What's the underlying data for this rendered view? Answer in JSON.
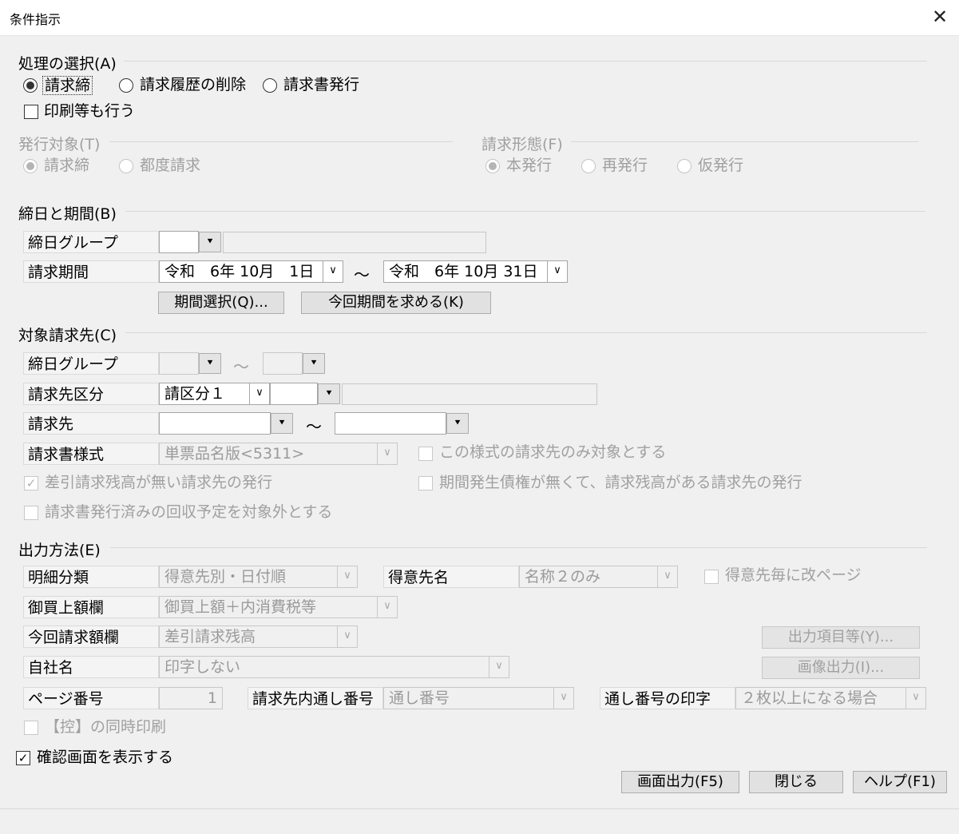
{
  "window": {
    "title": "条件指示"
  },
  "processing": {
    "group_label": "処理の選択(A)",
    "options": [
      "請求締",
      "請求履歴の削除",
      "請求書発行"
    ],
    "print_check": "印刷等も行う"
  },
  "issue_target": {
    "label": "発行対象(T)",
    "options": [
      "請求締",
      "都度請求"
    ]
  },
  "billing_form": {
    "label": "請求形態(F)",
    "options": [
      "本発行",
      "再発行",
      "仮発行"
    ]
  },
  "period": {
    "group_label": "締日と期間(B)",
    "closing_group_label": "締日グループ",
    "billing_period_label": "請求期間",
    "from": "令和　6年 10月　1日",
    "to": "令和　6年 10月 31日",
    "tilde": "～",
    "select_button": "期間選択(Q)...",
    "calc_button": "今回期間を求める(K)"
  },
  "target": {
    "group_label": "対象請求先(C)",
    "closing_group_label": "締日グループ",
    "tilde": "～",
    "category_label": "請求先区分",
    "category_value": "請区分１",
    "customer_label": "請求先",
    "style_label": "請求書様式",
    "style_value": "単票品名版<5311>",
    "only_style_check": "この様式の請求先のみ対象とする",
    "no_balance_check": "差引請求残高が無い請求先の発行",
    "no_debt_check": "期間発生債権が無くて、請求残高がある請求先の発行",
    "exclude_check": "請求書発行済みの回収予定を対象外とする"
  },
  "output": {
    "group_label": "出力方法(E)",
    "detail_label": "明細分類",
    "detail_value": "得意先別・日付順",
    "customer_name_label": "得意先名",
    "customer_name_value": "名称２のみ",
    "page_break_check": "得意先毎に改ページ",
    "purchase_label": "御買上額欄",
    "purchase_value": "御買上額＋内消費税等",
    "current_label": "今回請求額欄",
    "current_value": "差引請求残高",
    "output_items_button": "出力項目等(Y)...",
    "company_label": "自社名",
    "company_value": "印字しない",
    "image_button": "画像出力(I)...",
    "page_no_label": "ページ番号",
    "page_no_value": "1",
    "serial_label": "請求先内通し番号",
    "serial_value": "通し番号",
    "serial_print_label": "通し番号の印字",
    "serial_print_value": "２枚以上になる場合",
    "copy_check": "【控】の同時印刷"
  },
  "footer": {
    "confirm_check": "確認画面を表示する",
    "screen_button": "画面出力(F5)",
    "close_button": "閉じる",
    "help_button": "ヘルプ(F1)"
  }
}
